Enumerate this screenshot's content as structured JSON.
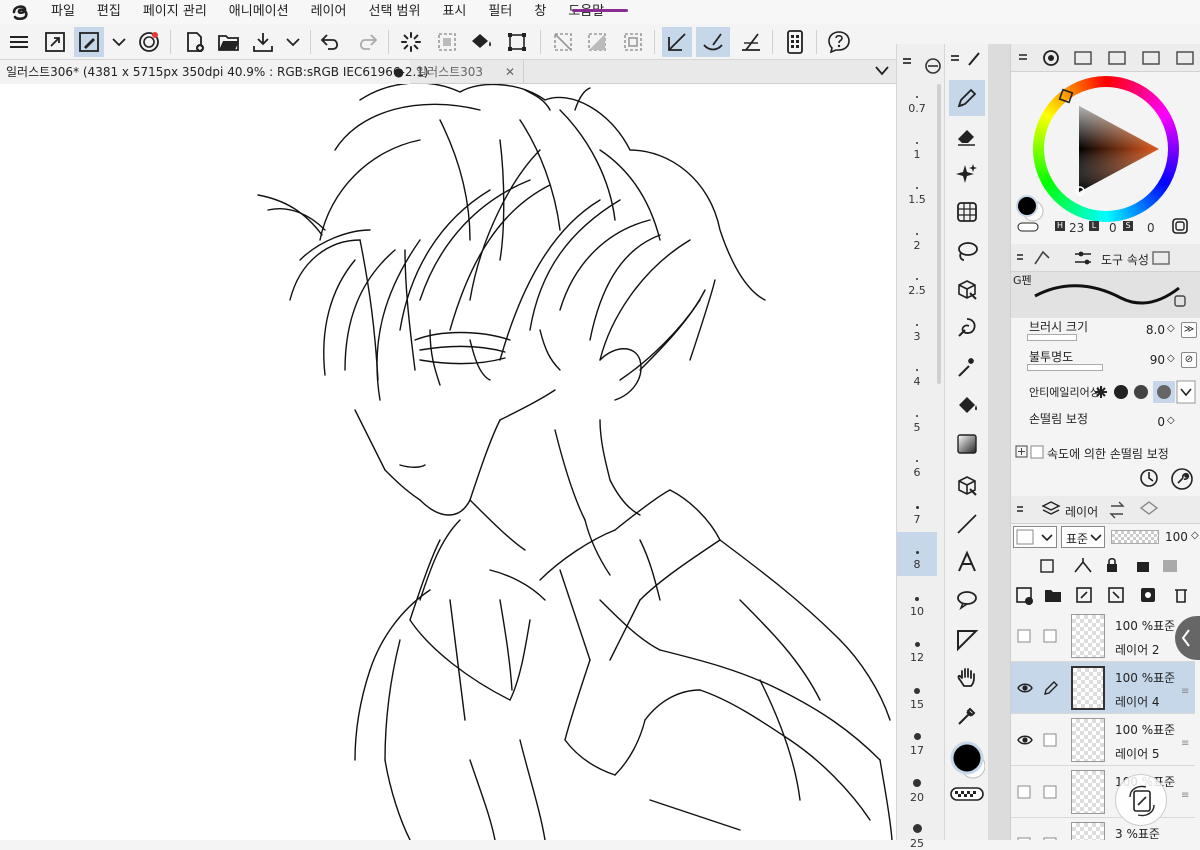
{
  "menu": {
    "items": [
      "파일",
      "편집",
      "페이지 관리",
      "애니메이션",
      "레이어",
      "선택 범위",
      "표시",
      "필터",
      "창",
      "도움말"
    ]
  },
  "toolbar": {
    "icons": [
      "menu-icon",
      "fullscreen-icon",
      "brush-edit-icon",
      "chevron-down-icon",
      "spiral-icon",
      "new-file-icon",
      "open-folder-icon",
      "save-icon",
      "chevron-down-icon",
      "undo-icon",
      "redo-icon",
      "loading-icon",
      "clear-selection-icon",
      "fill-icon",
      "transform-icon",
      "deselect-icon",
      "invert-selection-icon",
      "selection-border-icon",
      "ruler-snap-icon",
      "pen-ruler-icon",
      "perspective-icon",
      "device-icon",
      "help-icon"
    ]
  },
  "tabs": {
    "active_title": "일러스트306* (4381 x 5715px 350dpi 40.9% : RGB:sRGB IEC61966-2.1)",
    "active_dot": "●",
    "inactive_title": "일러스트303",
    "close_glyph": "✕"
  },
  "ruler": {
    "labels": [
      "0.7",
      "1",
      "1.5",
      "2",
      "2.5",
      "3",
      "4",
      "5",
      "6",
      "7",
      "8",
      "10",
      "12",
      "15",
      "17",
      "20",
      "25"
    ],
    "selected": "8"
  },
  "toolstrip": {
    "tools": [
      "pen-tool-icon",
      "eraser-tool-icon",
      "sparkle-tool-icon",
      "grid-tool-icon",
      "lasso-tool-icon",
      "cube-tool-icon",
      "blend-tool-icon",
      "magic-wand-icon",
      "bucket-tool-icon",
      "gradient-tool-icon",
      "3d-object-icon",
      "line-tool-icon",
      "text-tool-icon",
      "balloon-tool-icon",
      "frame-tool-icon",
      "hand-tool-icon",
      "eyedropper-tool-icon"
    ],
    "active": "pen-tool-icon"
  },
  "color": {
    "main": "#000000",
    "accent": "#c7d7ea",
    "h_label": "H",
    "h_value": "23",
    "l_label": "L",
    "l_value": "0",
    "s_label": "S",
    "s_value": "0"
  },
  "tool_props": {
    "tab_label": "도구 속성",
    "brush_name": "G펜",
    "brush_size_label": "브러시 크기",
    "brush_size_value": "8.0",
    "opacity_label": "불투명도",
    "opacity_value": "90",
    "antialias_label": "안티에일리어싱",
    "stabilization_label": "손떨림 보정",
    "stabilization_value": "0",
    "speed_stab_label": "속도에 의한 손떨림 보정"
  },
  "layers": {
    "tab_label": "레이어",
    "blend_mode": "표준",
    "opacity": "100",
    "rows": [
      {
        "blend": "100 %표준",
        "name": "레이어 2",
        "visible": false,
        "editing": false,
        "selected": false
      },
      {
        "blend": "100 %표준",
        "name": "레이어 4",
        "visible": true,
        "editing": true,
        "selected": true
      },
      {
        "blend": "100 %표준",
        "name": "레이어 5",
        "visible": true,
        "editing": false,
        "selected": false
      },
      {
        "blend": "100 %표준",
        "name": "",
        "visible": false,
        "editing": false,
        "selected": false
      },
      {
        "blend": "3 %표준",
        "name": "",
        "visible": false,
        "editing": false,
        "selected": false
      }
    ]
  }
}
